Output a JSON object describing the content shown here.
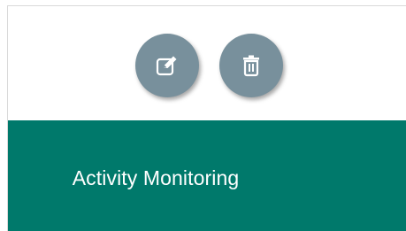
{
  "actions": {
    "edit_icon": "edit-icon",
    "delete_icon": "trash-icon",
    "button_color": "#78909c"
  },
  "banner": {
    "title": "Activity Monitoring",
    "color": "#00796b"
  }
}
